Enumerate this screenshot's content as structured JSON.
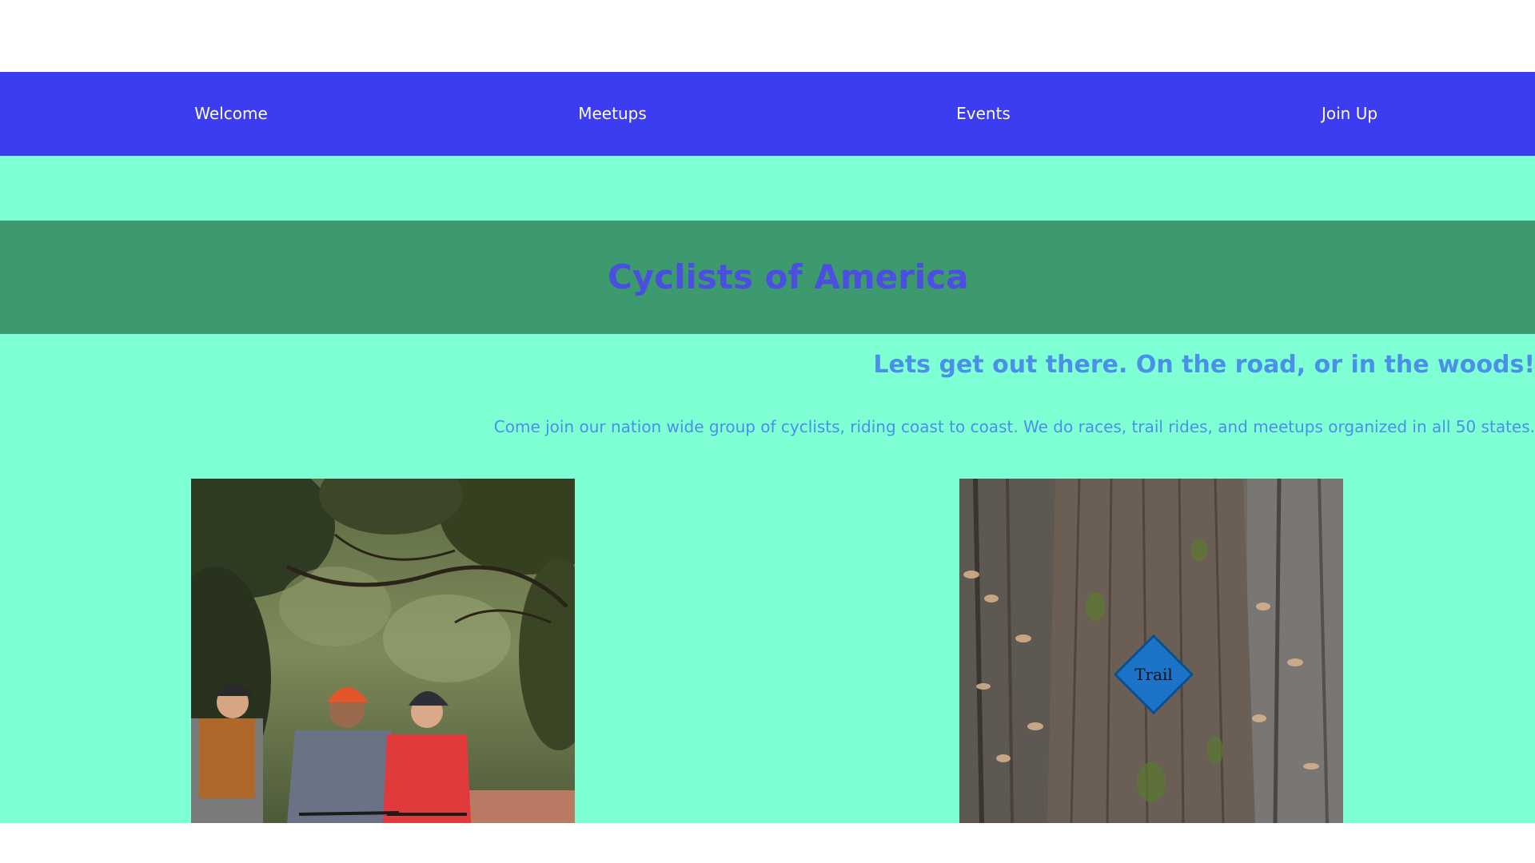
{
  "nav": {
    "items": [
      {
        "label": "Welcome"
      },
      {
        "label": "Meetups"
      },
      {
        "label": "Events"
      },
      {
        "label": "Join Up"
      }
    ]
  },
  "banner": {
    "title": "Cyclists of America"
  },
  "hero": {
    "tagline": "Lets get out there. On the road, or in the woods!",
    "intro": "Come join our nation wide group of cyclists, riding coast to coast. We do races, trail rides, and meetups organized in all 50 states."
  },
  "photos": {
    "trail_sign_text": "Trail"
  },
  "colors": {
    "nav_background": "#3c3cf0",
    "page_background": "#7fffd4",
    "banner_background": "#3c9a6e",
    "banner_title": "#4b4ee0",
    "text_blue": "#4a90e8"
  }
}
